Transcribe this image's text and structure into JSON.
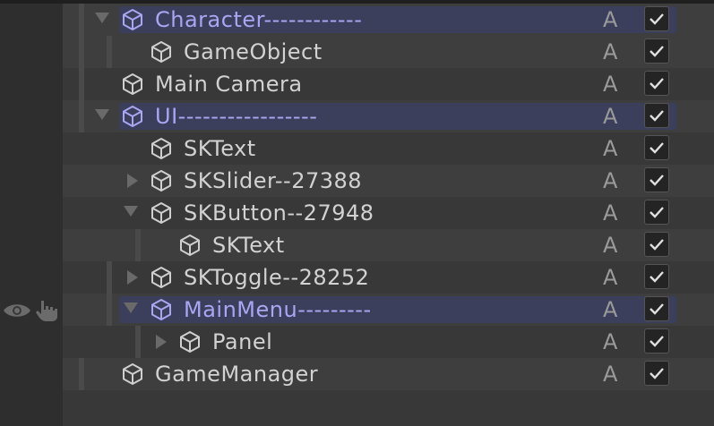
{
  "hierarchy": {
    "rows": [
      {
        "name": "Character------------",
        "expanded": true,
        "selected": true,
        "blue": true
      },
      {
        "name": "GameObject"
      },
      {
        "name": "Main Camera"
      },
      {
        "name": "UI-----------------",
        "expanded": true,
        "selected": true,
        "blue": true
      },
      {
        "name": "SKText"
      },
      {
        "name": "SKSlider--27388",
        "collapsed": true
      },
      {
        "name": "SKButton--27948",
        "expanded": true
      },
      {
        "name": "SKText"
      },
      {
        "name": "SKToggle--28252",
        "collapsed": true
      },
      {
        "name": "MainMenu---------",
        "expanded": true,
        "selected": true,
        "blue": true,
        "hovered": true
      },
      {
        "name": "Panel",
        "collapsed": true
      },
      {
        "name": "GameManager"
      }
    ],
    "a_label": "A",
    "icons": {
      "object": "cube-icon",
      "visibility": "eye-icon",
      "pickable": "hand-icon",
      "active": "checkmark-icon"
    },
    "colors": {
      "background": "#383838",
      "selection": "#3b3f5c",
      "selected_text": "#a9a6f2",
      "text": "#d2d2d2"
    }
  }
}
